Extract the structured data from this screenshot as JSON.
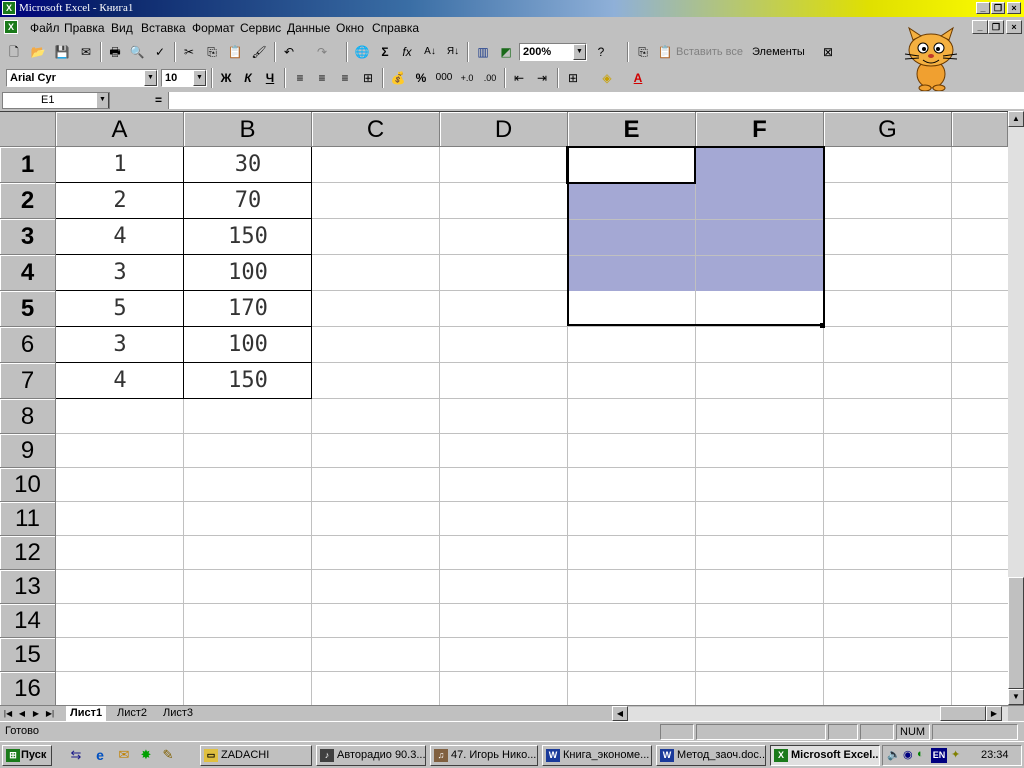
{
  "window": {
    "title": "Microsoft Excel - Книга1"
  },
  "menu": {
    "items": [
      "Файл",
      "Правка",
      "Вид",
      "Вставка",
      "Формат",
      "Сервис",
      "Данные",
      "Окно",
      "Справка"
    ]
  },
  "toolbar_standard": {
    "zoom": "200%",
    "paste_all": "Вставить все",
    "elements": "Элементы"
  },
  "toolbar_format": {
    "font": "Arial Cyr",
    "size": "10",
    "bold": "Ж",
    "italic": "К",
    "underline": "Ч",
    "percent": "%",
    "thousands": "000"
  },
  "formula_bar": {
    "cell_ref": "E1",
    "eq": "=",
    "value": ""
  },
  "sheet": {
    "columns": [
      "A",
      "B",
      "C",
      "D",
      "E",
      "F",
      "G"
    ],
    "rows": [
      "1",
      "2",
      "3",
      "4",
      "5",
      "6",
      "7",
      "8",
      "9",
      "10",
      "11",
      "12",
      "13",
      "14",
      "15",
      "16"
    ],
    "col_a": [
      "1",
      "2",
      "4",
      "3",
      "5",
      "3",
      "4"
    ],
    "col_b": [
      "30",
      "70",
      "150",
      "100",
      "170",
      "100",
      "150"
    ],
    "selected_range": "E1:F5",
    "selection_color": "#a4a8d4"
  },
  "sheet_tabs": [
    "Лист1",
    "Лист2",
    "Лист3"
  ],
  "status": {
    "ready": "Готово",
    "num": "NUM"
  },
  "taskbar": {
    "start": "Пуск",
    "buttons": [
      "ZADACHI",
      "Авторадио 90.3...",
      "47. Игорь Нико...",
      "Книга_экономе...",
      "Метод_заоч.doc...",
      "Microsoft Excel..."
    ],
    "lang": "EN",
    "clock": "23:34"
  }
}
